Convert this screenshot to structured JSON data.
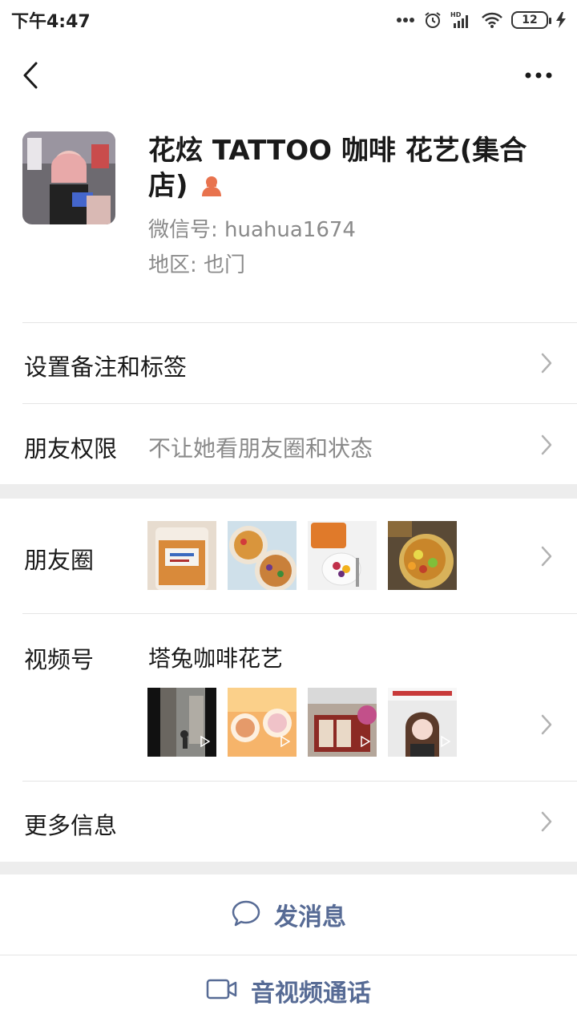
{
  "status_bar": {
    "time": "下午4:47",
    "battery": "12",
    "network": "HD"
  },
  "profile": {
    "name": "花炫 TATTOO 咖啡 花艺(集合店)",
    "wechat_id": "微信号: huahua1674",
    "region": "地区: 也门",
    "gender_icon": "female-icon"
  },
  "rows": {
    "remark": {
      "label": "设置备注和标签"
    },
    "permissions": {
      "label": "朋友权限",
      "value": "不让她看朋友圈和状态"
    },
    "moments": {
      "label": "朋友圈"
    },
    "channels": {
      "label": "视频号",
      "value": "塔兔咖啡花艺"
    },
    "more_info": {
      "label": "更多信息"
    }
  },
  "actions": {
    "message": {
      "label": "发消息",
      "icon": "chat-bubble-icon"
    },
    "call": {
      "label": "音视频通话",
      "icon": "video-camera-icon"
    }
  },
  "colors": {
    "link": "#576b95",
    "gender": "#e8734e",
    "section_gap": "#ededed"
  }
}
